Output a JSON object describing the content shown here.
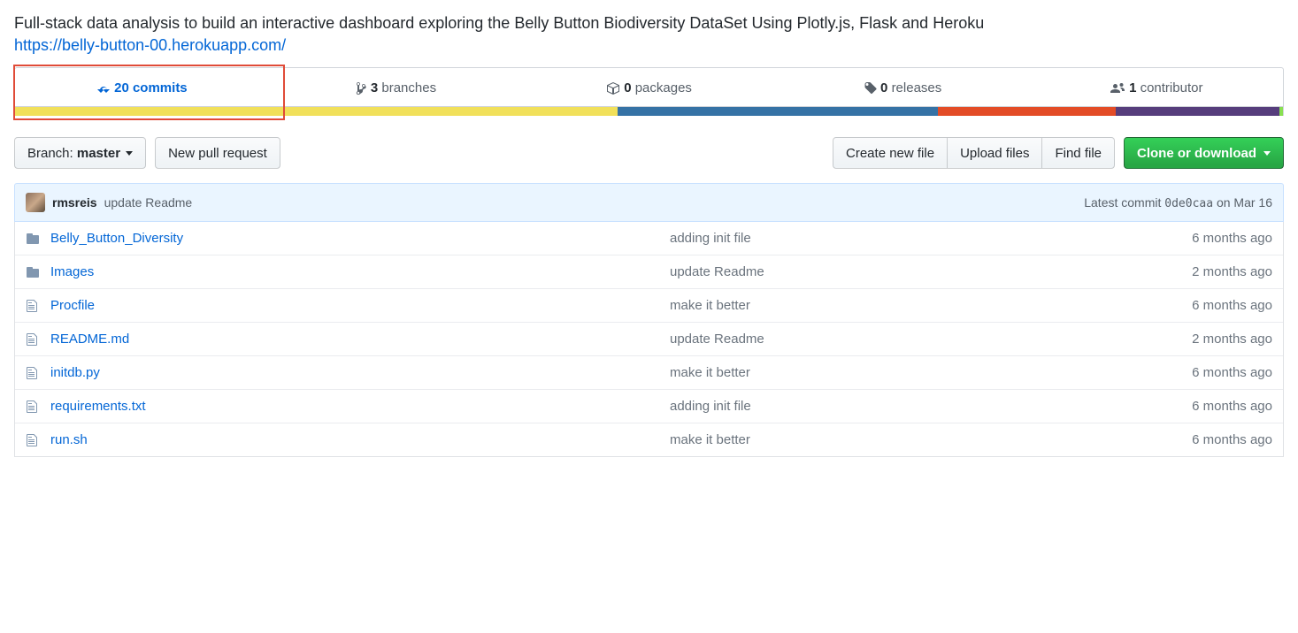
{
  "description": "Full-stack data analysis to build an interactive dashboard exploring the Belly Button Biodiversity DataSet Using Plotly.js, Flask and Heroku",
  "repo_url": "https://belly-button-00.herokuapp.com/",
  "summary": {
    "commits_count": "20",
    "commits_label": "commits",
    "branches_count": "3",
    "branches_label": "branches",
    "packages_count": "0",
    "packages_label": "packages",
    "releases_count": "0",
    "releases_label": "releases",
    "contributors_count": "1",
    "contributors_label": "contributor"
  },
  "langbar": [
    {
      "color": "#f1e05a",
      "pct": 47.5
    },
    {
      "color": "#3572A5",
      "pct": 25.3
    },
    {
      "color": "#e34c26",
      "pct": 14.0
    },
    {
      "color": "#563d7c",
      "pct": 12.9
    },
    {
      "color": "#89e051",
      "pct": 0.3
    }
  ],
  "toolbar": {
    "branch_prefix": "Branch:",
    "branch_name": "master",
    "new_pr": "New pull request",
    "create_file": "Create new file",
    "upload": "Upload files",
    "find": "Find file",
    "clone": "Clone or download"
  },
  "tease": {
    "author": "rmsreis",
    "message": "update Readme",
    "latest_prefix": "Latest commit",
    "sha": "0de0caa",
    "when": "on Mar 16"
  },
  "files": [
    {
      "type": "dir",
      "name": "Belly_Button_Diversity",
      "msg": "adding init file",
      "age": "6 months ago"
    },
    {
      "type": "dir",
      "name": "Images",
      "msg": "update Readme",
      "age": "2 months ago"
    },
    {
      "type": "file",
      "name": "Procfile",
      "msg": "make it better",
      "age": "6 months ago"
    },
    {
      "type": "file",
      "name": "README.md",
      "msg": "update Readme",
      "age": "2 months ago"
    },
    {
      "type": "file",
      "name": "initdb.py",
      "msg": "make it better",
      "age": "6 months ago"
    },
    {
      "type": "file",
      "name": "requirements.txt",
      "msg": "adding init file",
      "age": "6 months ago"
    },
    {
      "type": "file",
      "name": "run.sh",
      "msg": "make it better",
      "age": "6 months ago"
    }
  ]
}
